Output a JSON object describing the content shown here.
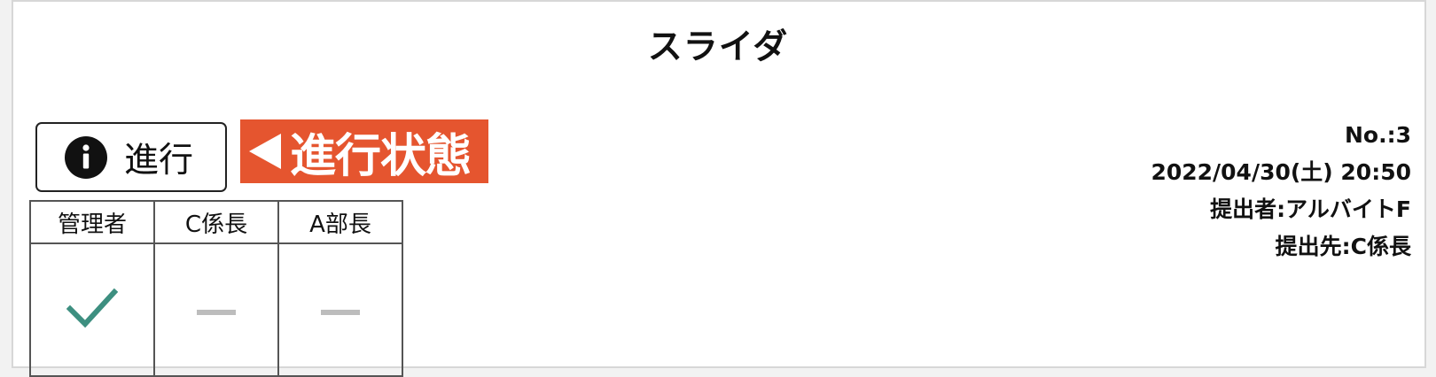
{
  "page": {
    "title": "スライダ"
  },
  "progress_button": {
    "label": "進行",
    "icon": "info-icon"
  },
  "status_badge": {
    "label": "進行状態",
    "color": "#e5552f",
    "icon": "triangle-left-icon"
  },
  "approvals": {
    "columns": [
      "管理者",
      "C係長",
      "A部長"
    ],
    "states": [
      "approved",
      "pending",
      "pending"
    ],
    "check_color": "#3d8f80"
  },
  "meta": {
    "number": "No.:3",
    "datetime": "2022/04/30(土) 20:50",
    "submitter": "提出者:アルバイトF",
    "destination": "提出先:C係長"
  }
}
